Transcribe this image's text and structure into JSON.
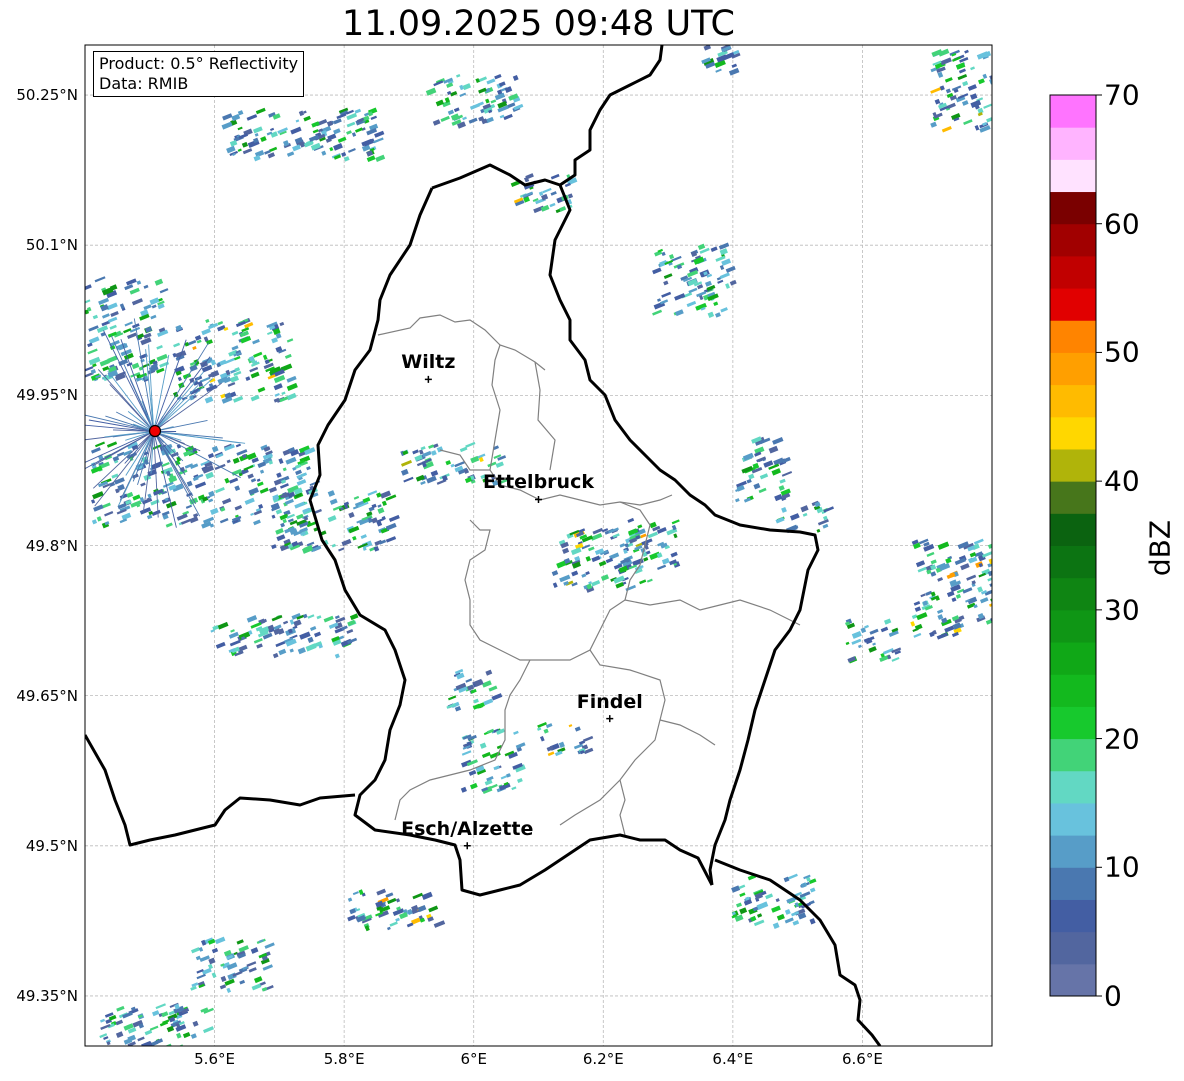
{
  "title": "11.09.2025 09:48 UTC",
  "info": {
    "product": "Product: 0.5° Reflectivity",
    "data": "Data: RMIB"
  },
  "map": {
    "lon_range": [
      5.4,
      6.8
    ],
    "lat_range": [
      49.3,
      50.3
    ],
    "lat_ticks": [
      {
        "value": 50.25,
        "label": "50.25°N"
      },
      {
        "value": 50.1,
        "label": "50.1°N"
      },
      {
        "value": 49.95,
        "label": "49.95°N"
      },
      {
        "value": 49.8,
        "label": "49.8°N"
      },
      {
        "value": 49.65,
        "label": "49.65°N"
      },
      {
        "value": 49.5,
        "label": "49.5°N"
      },
      {
        "value": 49.35,
        "label": "49.35°N"
      }
    ],
    "lon_ticks": [
      {
        "value": 5.6,
        "label": "5.6°E"
      },
      {
        "value": 5.8,
        "label": "5.8°E"
      },
      {
        "value": 6.0,
        "label": "6°E"
      },
      {
        "value": 6.2,
        "label": "6.2°E"
      },
      {
        "value": 6.4,
        "label": "6.4°E"
      },
      {
        "value": 6.6,
        "label": "6.6°E"
      }
    ],
    "cities": [
      {
        "name": "Wiltz",
        "lon": 5.93,
        "lat": 49.966
      },
      {
        "name": "Ettelbruck",
        "lon": 6.1,
        "lat": 49.846
      },
      {
        "name": "Findel",
        "lon": 6.21,
        "lat": 49.627
      },
      {
        "name": "Esch/Alzette",
        "lon": 5.99,
        "lat": 49.5
      }
    ],
    "radar_site": {
      "lon": 5.506,
      "lat": 49.914
    },
    "grid": true
  },
  "colorbar": {
    "unit": "dBZ",
    "min": 0,
    "max": 70,
    "step": 2.5,
    "ticks": [
      0,
      10,
      20,
      30,
      40,
      50,
      60,
      70
    ],
    "colors": [
      "#6674a8",
      "#52669f",
      "#435ea3",
      "#4a78b0",
      "#579dc8",
      "#68c2dd",
      "#62d8c3",
      "#42d378",
      "#17c92d",
      "#13b91e",
      "#10a817",
      "#0f9615",
      "#0f8513",
      "#0c7412",
      "#0b6310",
      "#47761b",
      "#b0b40a",
      "#ffd700",
      "#ffbb00",
      "#ff9f00",
      "#ff8400",
      "#e10000",
      "#c10000",
      "#a10000",
      "#7a0000",
      "#ffe2ff",
      "#ffb4ff",
      "#ff74ff",
      "#ee3cee"
    ]
  }
}
